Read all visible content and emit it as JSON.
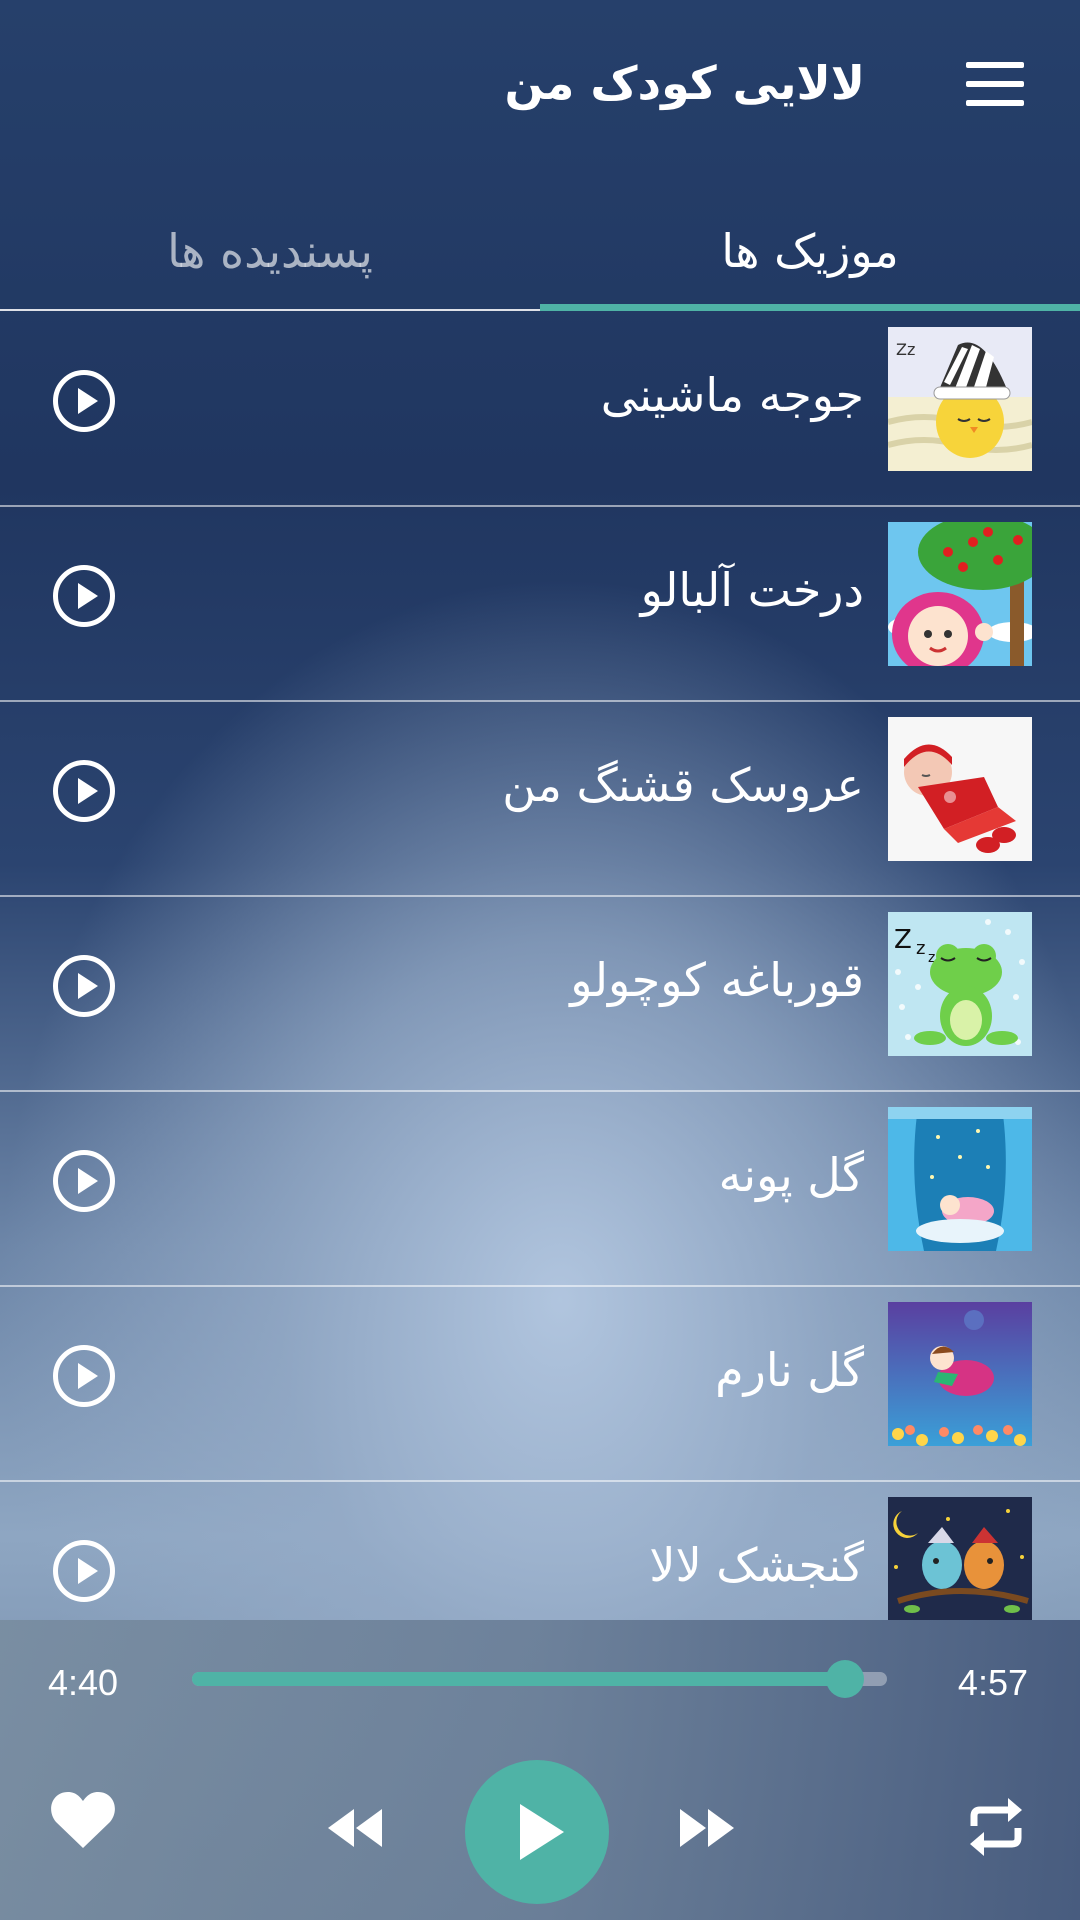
{
  "header": {
    "title": "لالایی کودک من",
    "menu_icon": "hamburger-menu-icon"
  },
  "tabs": [
    {
      "label": "موزیک ها",
      "active": true
    },
    {
      "label": "پسندیده ها",
      "active": false
    }
  ],
  "accent_color": "#4fb3a6",
  "songs": [
    {
      "title": "جوجه ماشینی",
      "thumbnail": "sleeping-chick-image"
    },
    {
      "title": "درخت آلبالو",
      "thumbnail": "girl-cherry-tree-image"
    },
    {
      "title": "عروسک قشنگ من",
      "thumbnail": "baby-doll-red-dress-image"
    },
    {
      "title": "قورباغه کوچولو",
      "thumbnail": "sleeping-frog-image"
    },
    {
      "title": "گل پونه",
      "thumbnail": "baby-on-moon-curtains-image"
    },
    {
      "title": "گل نارم",
      "thumbnail": "boy-on-crescent-moon-image"
    },
    {
      "title": "گنجشک لالا",
      "thumbnail": "two-birds-night-image"
    }
  ],
  "player": {
    "elapsed": "4:40",
    "total": "4:57",
    "progress": 0.94,
    "controls": [
      "heart-icon",
      "rewind-icon",
      "play-icon",
      "fast-forward-icon",
      "repeat-icon"
    ]
  }
}
